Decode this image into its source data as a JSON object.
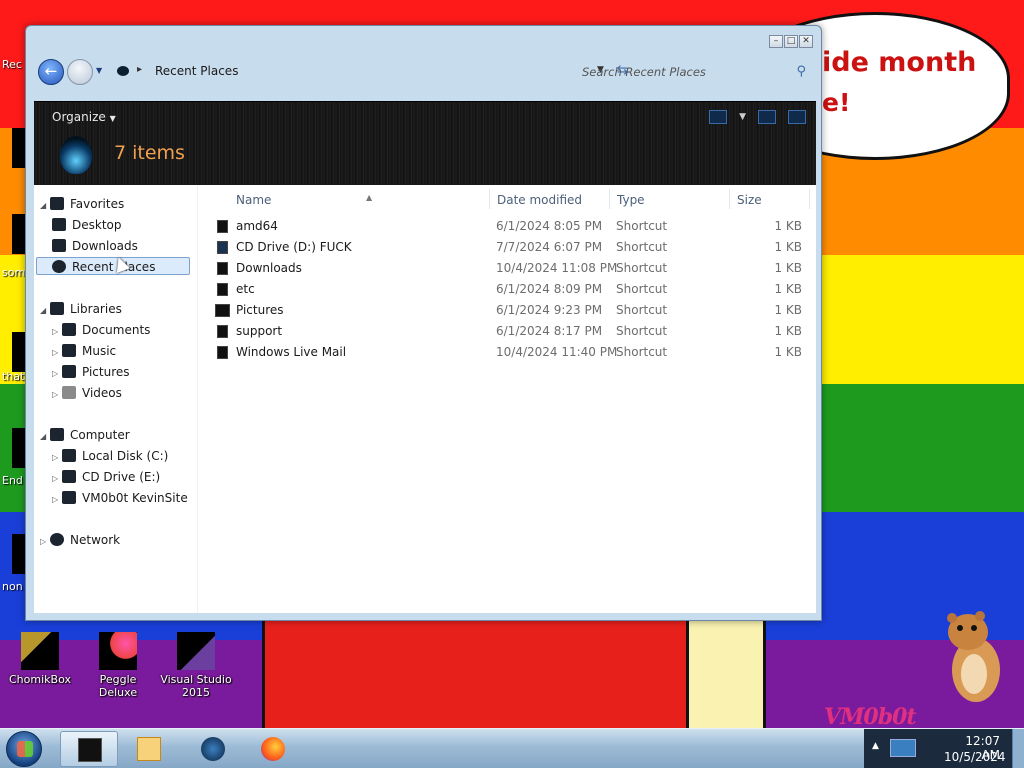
{
  "desktop": {
    "speech_line1": "ide month",
    "speech_line2": "e!",
    "icons": [
      {
        "label": "ChomikBox"
      },
      {
        "label": "Peggle Deluxe"
      },
      {
        "label": "Visual Studio 2015"
      }
    ],
    "edge_labels": [
      "Rec",
      "",
      "som re",
      "that",
      "End",
      "non reta"
    ],
    "watermark": "VM0b0t"
  },
  "window": {
    "address": {
      "location": "Recent Places",
      "search_placeholder": "Search Recent Places"
    },
    "commandbar": {
      "organize_label": "Organize",
      "item_count": "7 items"
    },
    "navpane": {
      "favorites": {
        "label": "Favorites",
        "items": [
          "Desktop",
          "Downloads",
          "Recent Places"
        ]
      },
      "libraries": {
        "label": "Libraries",
        "items": [
          "Documents",
          "Music",
          "Pictures",
          "Videos"
        ]
      },
      "computer": {
        "label": "Computer",
        "items": [
          "Local Disk (C:)",
          "CD Drive (E:)",
          "VM0b0t KevinSite"
        ]
      },
      "network": {
        "label": "Network"
      }
    },
    "columns": {
      "name": "Name",
      "date": "Date modified",
      "type": "Type",
      "size": "Size"
    },
    "files": [
      {
        "name": "amd64",
        "date": "6/1/2024 8:05 PM",
        "type": "Shortcut",
        "size": "1 KB"
      },
      {
        "name": "CD Drive (D:) FUCK",
        "date": "7/7/2024 6:07 PM",
        "type": "Shortcut",
        "size": "1 KB"
      },
      {
        "name": "Downloads",
        "date": "10/4/2024 11:08 PM",
        "type": "Shortcut",
        "size": "1 KB"
      },
      {
        "name": "etc",
        "date": "6/1/2024 8:09 PM",
        "type": "Shortcut",
        "size": "1 KB"
      },
      {
        "name": "Pictures",
        "date": "6/1/2024 9:23 PM",
        "type": "Shortcut",
        "size": "1 KB"
      },
      {
        "name": "support",
        "date": "6/1/2024 8:17 PM",
        "type": "Shortcut",
        "size": "1 KB"
      },
      {
        "name": "Windows Live Mail",
        "date": "10/4/2024 11:40 PM",
        "type": "Shortcut",
        "size": "1 KB"
      }
    ]
  },
  "taskbar": {
    "clock_time": "12:07 AM",
    "clock_date": "10/5/2024"
  }
}
